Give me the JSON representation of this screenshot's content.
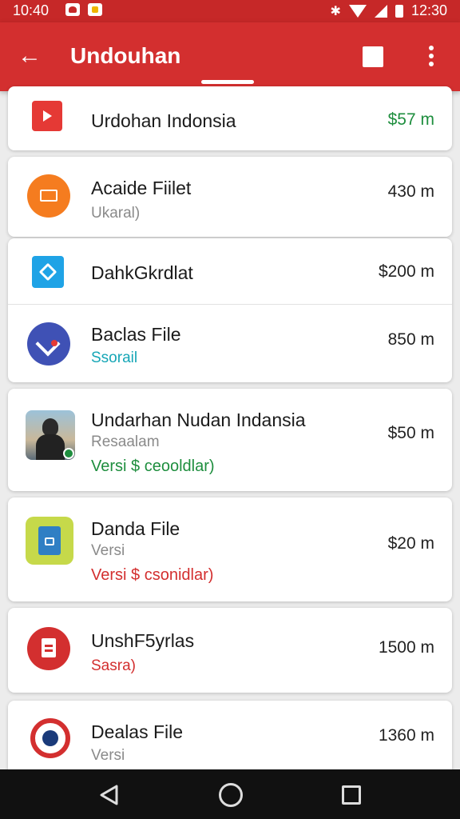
{
  "status": {
    "time": "10:40",
    "right_time": "12:30"
  },
  "appbar": {
    "title": "Undouhan"
  },
  "items": [
    {
      "name": "Urdohan Indonsia",
      "size": "$57 m"
    },
    {
      "name": "Acaide Fiilet",
      "sub": "Ukaral)",
      "size": "430 m"
    },
    {
      "name": "DahkGkrdlat",
      "size": "$200 m"
    },
    {
      "name": "Baclas File",
      "sub": "Ssorail",
      "size": "850 m"
    },
    {
      "name": "Undarhan Nudan Indansia",
      "sub": "Resaalam",
      "version": "Versi $ ceooldlar)",
      "size": "$50 m"
    },
    {
      "name": "Danda File",
      "sub": "Versi",
      "version": "Versi $ csonidlar)",
      "size": "$20 m"
    },
    {
      "name": "UnshF5yrlas",
      "sub": "Sasra)",
      "size": "1500 m"
    },
    {
      "name": "Dealas File",
      "sub": "Versi",
      "size": "1360 m"
    }
  ],
  "colors": {
    "primary": "#d32f2f",
    "status_bar": "#c62828",
    "green": "#1e8e3e",
    "teal": "#16a6b6"
  }
}
